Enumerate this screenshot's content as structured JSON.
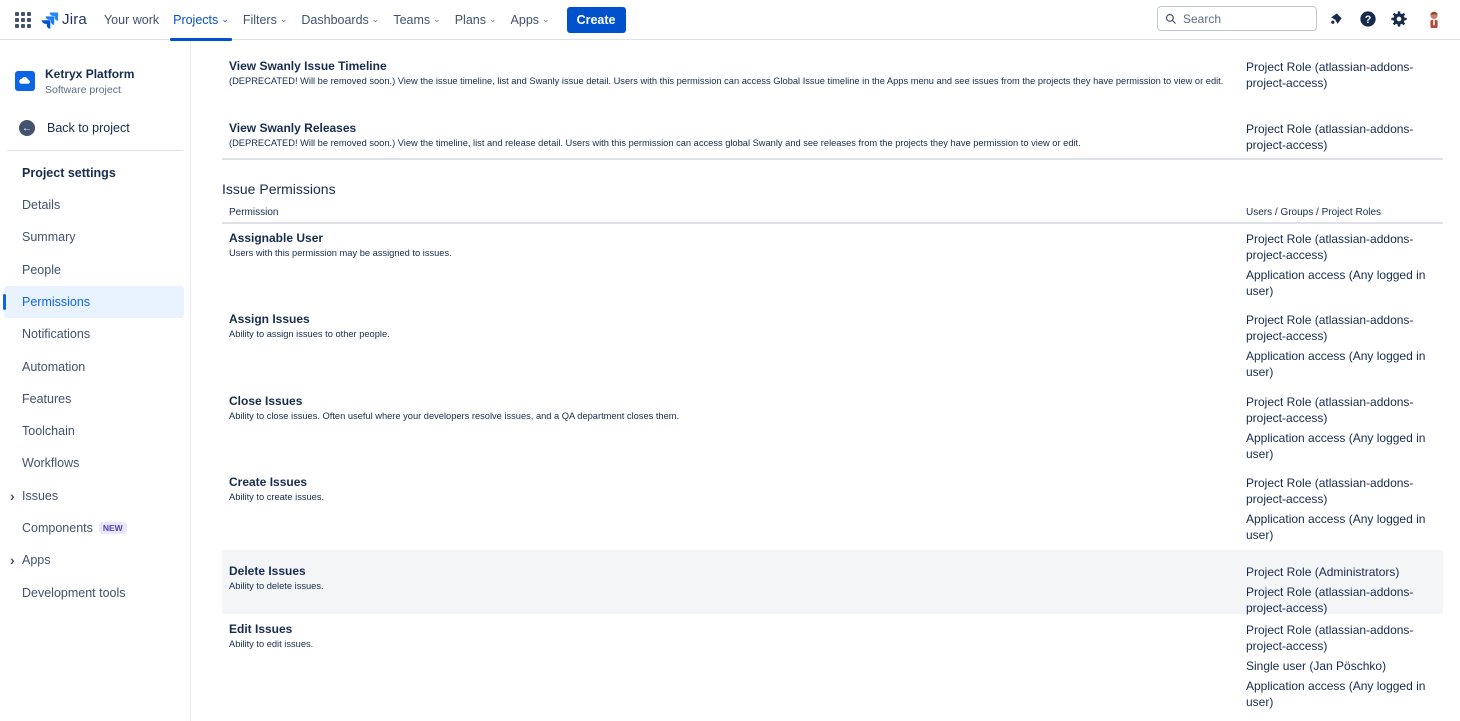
{
  "topnav": {
    "logo_text": "Jira",
    "items": [
      {
        "label": "Your work",
        "active": false
      },
      {
        "label": "Projects",
        "active": true
      },
      {
        "label": "Filters",
        "active": false
      },
      {
        "label": "Dashboards",
        "active": false
      },
      {
        "label": "Teams",
        "active": false
      },
      {
        "label": "Plans",
        "active": false
      },
      {
        "label": "Apps",
        "active": false
      }
    ],
    "create_label": "Create",
    "search_placeholder": "Search",
    "icons": [
      "notifications-icon",
      "help-icon",
      "settings-icon",
      "profile-avatar"
    ]
  },
  "sidebar": {
    "project_name": "Ketryx Platform",
    "project_type": "Software project",
    "back_label": "Back to project",
    "section_heading": "Project settings",
    "items": [
      {
        "label": "Details"
      },
      {
        "label": "Summary"
      },
      {
        "label": "People"
      },
      {
        "label": "Permissions",
        "active": true
      },
      {
        "label": "Notifications"
      },
      {
        "label": "Automation"
      },
      {
        "label": "Features"
      },
      {
        "label": "Toolchain"
      },
      {
        "label": "Workflows"
      },
      {
        "label": "Issues",
        "expandable": true
      },
      {
        "label": "Components",
        "badge": "NEW"
      },
      {
        "label": "Apps",
        "expandable": true
      },
      {
        "label": "Development tools"
      }
    ]
  },
  "main": {
    "top_rows": [
      {
        "title": "View Swanly Issue Timeline",
        "description": "(DEPRECATED! Will be removed soon.) View the issue timeline, list and Swanly issue detail. Users with this permission can access Global Issue timeline in the Apps menu and see issues from the projects they have permission to view or edit.",
        "grants": [
          "Project Role (atlassian-addons-project-access)"
        ]
      },
      {
        "title": "View Swanly Releases",
        "description": "(DEPRECATED! Will be removed soon.) View the timeline, list and release detail. Users with this permission can access global Swanly and see releases from the projects they have permission to view or edit.",
        "grants": [
          "Project Role (atlassian-addons-project-access)"
        ]
      }
    ],
    "section_title": "Issue Permissions",
    "col_permission": "Permission",
    "col_grants": "Users / Groups / Project Roles",
    "issue_rows": [
      {
        "title": "Assignable User",
        "description": "Users with this permission may be assigned to issues.",
        "grants": [
          "Project Role (atlassian-addons-project-access)",
          "Application access (Any logged in user)"
        ]
      },
      {
        "title": "Assign Issues",
        "description": "Ability to assign issues to other people.",
        "grants": [
          "Project Role (atlassian-addons-project-access)",
          "Application access (Any logged in user)"
        ]
      },
      {
        "title": "Close Issues",
        "description": "Ability to close issues. Often useful where your developers resolve issues, and a QA department closes them.",
        "grants": [
          "Project Role (atlassian-addons-project-access)",
          "Application access (Any logged in user)"
        ]
      },
      {
        "title": "Create Issues",
        "description": "Ability to create issues.",
        "grants": [
          "Project Role (atlassian-addons-project-access)",
          "Application access (Any logged in user)"
        ]
      },
      {
        "title": "Delete Issues",
        "description": "Ability to delete issues.",
        "grants": [
          "Project Role (Administrators)",
          "Project Role (atlassian-addons-project-access)"
        ],
        "highlighted": true
      },
      {
        "title": "Edit Issues",
        "description": "Ability to edit issues.",
        "grants": [
          "Project Role (atlassian-addons-project-access)",
          "Single user (Jan Pöschko)",
          "Application access (Any logged in user)"
        ]
      }
    ]
  }
}
